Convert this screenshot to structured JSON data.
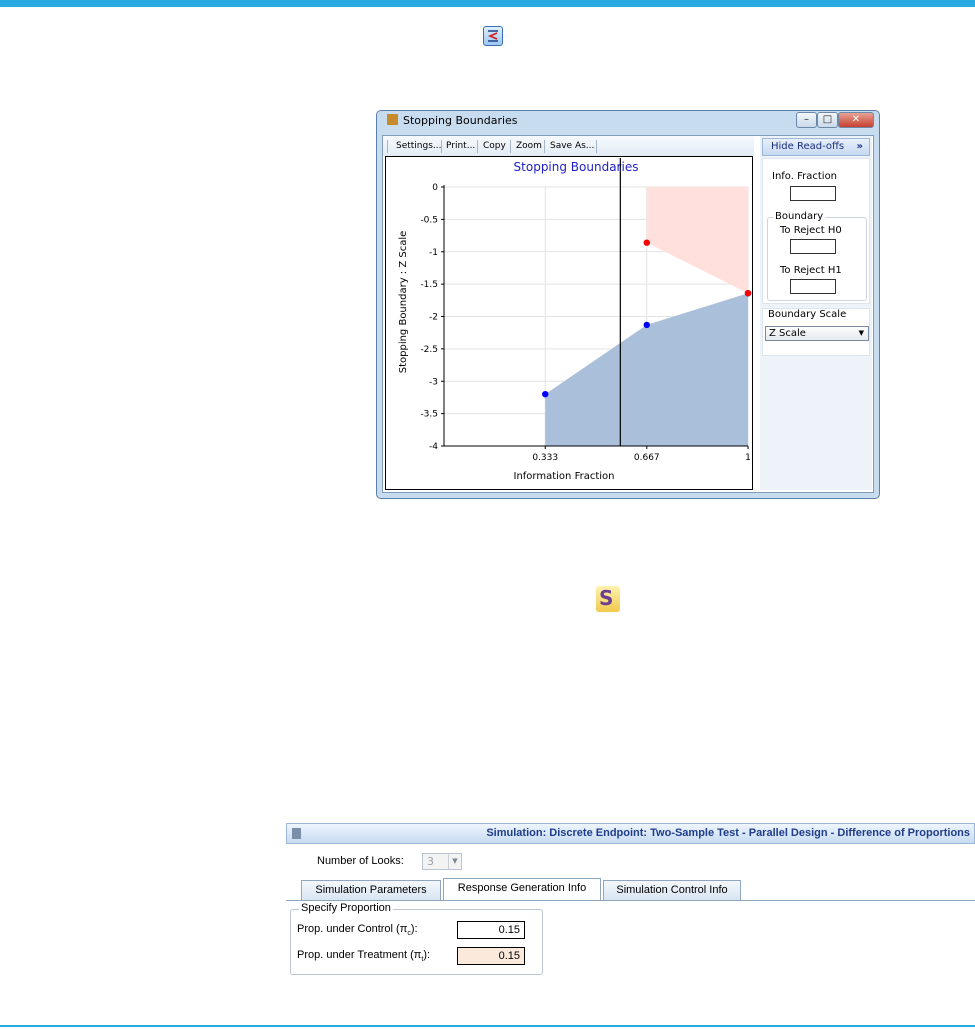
{
  "icons": {
    "chart_tool": "boundary-chart-icon",
    "simulation_tool": "simulation-s-icon",
    "simulation_letter": "S"
  },
  "window": {
    "title": "Stopping Boundaries",
    "controls": [
      "minimize",
      "maximize",
      "close"
    ],
    "toolbar": [
      "Settings...",
      "Print...",
      "Copy",
      "Zoom",
      "Save As..."
    ]
  },
  "chart_data": {
    "type": "area",
    "title": "Stopping Boundaries",
    "xlabel": "Information Fraction",
    "ylabel": "Stopping Boundary : Z Scale",
    "xlim": [
      0.0,
      1.0
    ],
    "ylim": [
      -4,
      0
    ],
    "x_ticks": [
      "0.333",
      "0.667",
      "1"
    ],
    "y_ticks": [
      "0",
      "-0.5",
      "-1",
      "-1.5",
      "-2",
      "-2.5",
      "-3",
      "-3.5",
      "-4"
    ],
    "grid": true,
    "reference_line_x": 0.58,
    "series": [
      {
        "color": "#0000ff",
        "fill": "#aabfd9",
        "x": [
          0.333,
          0.667,
          1.0
        ],
        "y": [
          -3.2,
          -2.13,
          -1.64
        ]
      },
      {
        "color": "#ff0000",
        "fill": "#ffe0dd",
        "x": [
          0.667,
          1.0
        ],
        "y": [
          -0.86,
          -1.64
        ]
      }
    ]
  },
  "side_panel": {
    "hide_button": "Hide Read-offs",
    "hide_chevron": "»",
    "info_fraction_label": "Info. Fraction",
    "boundary_group": "Boundary",
    "reject_h0": "To Reject H0",
    "reject_h1": "To Reject H1",
    "scale_label": "Boundary Scale",
    "scale_value": "Z Scale",
    "dropdown_arrow": "▼"
  },
  "simulation": {
    "title": "Simulation: Discrete Endpoint: Two-Sample Test - Parallel Design - Difference of Proportions",
    "looks_label": "Number of Looks:",
    "looks_value": "3",
    "tabs": [
      "Simulation Parameters",
      "Response Generation Info",
      "Simulation Control Info"
    ],
    "active_tab": 1,
    "group_title": "Specify Proportion",
    "control_label_pre": "Prop. under Control (π",
    "control_sub": "c",
    "control_label_post": "):",
    "control_value": "0.15",
    "treatment_label_pre": "Prop. under Treatment (π",
    "treatment_sub": "t",
    "treatment_label_post": "):",
    "treatment_value": "0.15",
    "treatment_box_color": "#fbeadb"
  }
}
